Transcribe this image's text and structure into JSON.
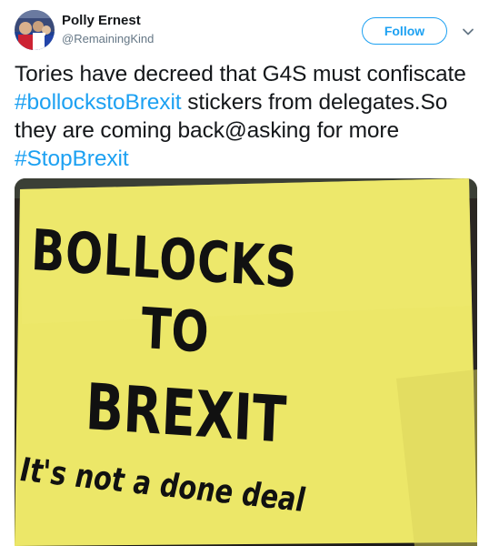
{
  "author": {
    "display_name": "Polly Ernest",
    "handle": "@RemainingKind"
  },
  "follow_label": "Follow",
  "tweet": {
    "segments": [
      {
        "text": "Tories have decreed that G4S must confiscate ",
        "hashtag": false
      },
      {
        "text": "#bollockstoBrexit",
        "hashtag": true
      },
      {
        "text": " stickers from delegates.So they are coming back@asking for more ",
        "hashtag": false
      },
      {
        "text": "#StopBrexit",
        "hashtag": true
      }
    ]
  },
  "media": {
    "sticker_lines": [
      "BOLLOCKS",
      "TO",
      "BREXIT",
      "It's not a done deal"
    ]
  },
  "colors": {
    "accent": "#1da1f2",
    "text": "#14171a",
    "muted": "#657786",
    "sticker": "#ece768"
  },
  "icons": {
    "more": "chevron-down-icon"
  }
}
